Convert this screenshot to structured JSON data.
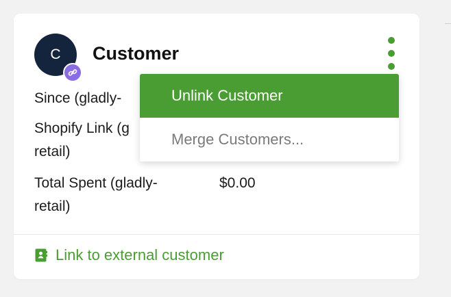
{
  "card": {
    "avatar_initial": "C",
    "title": "Customer",
    "fields": [
      {
        "label": "Since (gladly-",
        "value": ""
      },
      {
        "label": "Shopify Link (g\nretail)",
        "value": ""
      },
      {
        "label": "Total Spent (gladly-\nretail)",
        "value": "$0.00"
      }
    ],
    "footer_link_label": "Link to external customer"
  },
  "dropdown": {
    "items": [
      {
        "label": "Unlink Customer"
      },
      {
        "label": "Merge Customers..."
      }
    ]
  },
  "colors": {
    "accent": "#4a9d32",
    "avatar_background": "#15243d",
    "link_badge": "#8a6ce3"
  },
  "icons": {
    "link_badge": "link-icon",
    "more": "kebab-icon",
    "footer": "contact-book-icon"
  }
}
